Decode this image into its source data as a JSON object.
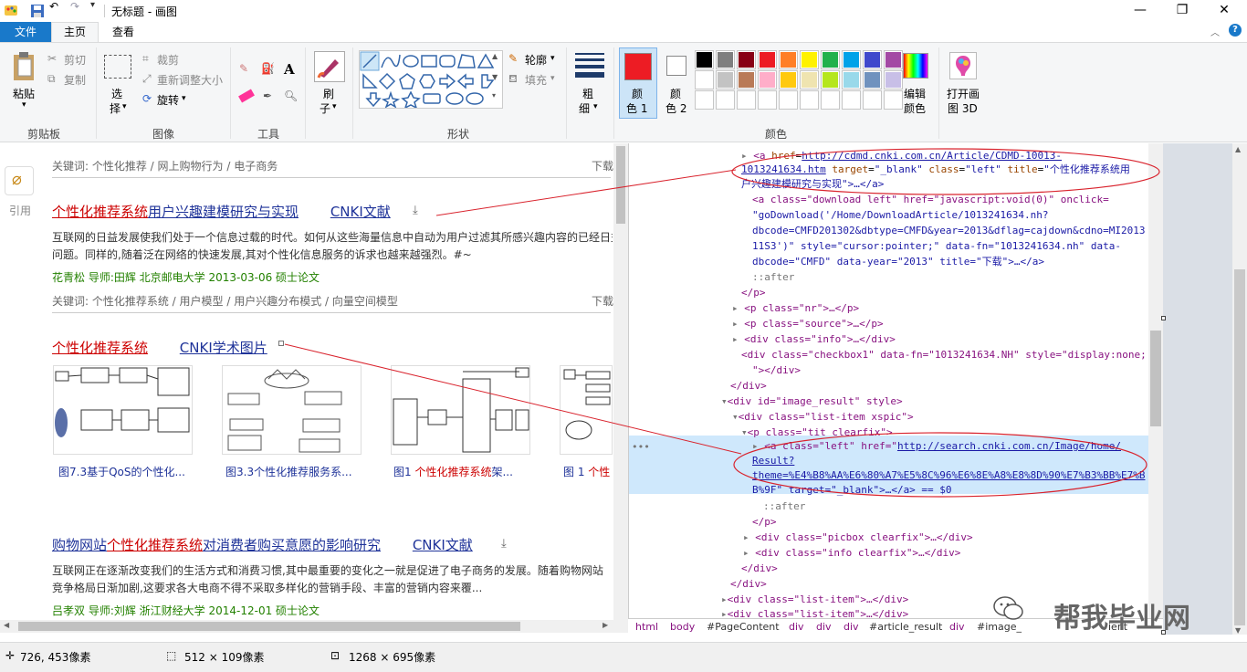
{
  "window": {
    "title": "无标题 - 画图"
  },
  "tabs": [
    "文件",
    "主页",
    "查看"
  ],
  "clipboard": {
    "paste": "粘贴",
    "cut": "剪切",
    "copy": "复制",
    "label": "剪贴板"
  },
  "image": {
    "select": "选",
    "select2": "择",
    "crop": "裁剪",
    "resize": "重新调整大小",
    "rotate": "旋转",
    "label": "图像"
  },
  "tools": {
    "label": "工具",
    "text_icon": "A"
  },
  "brush": {
    "l1": "刷",
    "l2": "子"
  },
  "shapes": {
    "outline": "轮廓",
    "fill": "填充",
    "label": "形状"
  },
  "size": {
    "l1": "粗",
    "l2": "细"
  },
  "colors": {
    "color1_l1": "颜",
    "color1_l2": "色 1",
    "color2_l1": "颜",
    "color2_l2": "色 2",
    "edit_l1": "编辑",
    "edit_l2": "颜色",
    "open3d_l1": "打开画",
    "open3d_l2": "图 3D",
    "label": "颜色",
    "color1": "#ed1c24",
    "color2": "#ffffff",
    "palette_row1": [
      "#000000",
      "#7f7f7f",
      "#880015",
      "#ed1c24",
      "#ff7f27",
      "#fff200",
      "#22b14c",
      "#00a2e8",
      "#3f48cc",
      "#a349a4"
    ],
    "palette_row2": [
      "#ffffff",
      "#c3c3c3",
      "#b97a57",
      "#ffaec9",
      "#ffc90e",
      "#efe4b0",
      "#b5e61d",
      "#99d9ea",
      "#7092be",
      "#c8bfe7"
    ]
  },
  "side": {
    "cite": "引用"
  },
  "results": {
    "kw1": "关键词:  个性化推荐 / 网上购物行为 / 电子商务",
    "dl": "下载",
    "r1_title_red": "个性化推荐系统",
    "r1_title_rest": "用户兴趣建模研究与实现",
    "r1_source": "CNKI文献",
    "r1_snip1": "互联网的日益发展使我们处于一个信息过载的时代。如何从这些海量信息中自动为用户过滤其所感兴趣内容的已经日益",
    "r1_snip2": "问题。同样的,随着泛在网络的快速发展,其对个性化信息服务的诉求也越来越强烈。#~",
    "r1_meta": "花青松  导师:田辉  北京邮电大学  2013-03-06  硕士论文",
    "kw2": "关键词:  个性化推荐系统 / 用户模型 / 用户兴趣分布模式 / 向量空间模型",
    "r2_title_red": "个性化推荐系统",
    "r2_source": "CNKI学术图片",
    "cap1": "图7.3基于QoS的个性化...",
    "cap2": "图3.3个性化推荐服务系...",
    "cap3_a": "图1  ",
    "cap3_red": "个性化推荐系统",
    "cap3_b": "架...",
    "cap4_a": "图 1  ",
    "cap4_red": "个性",
    "r3_title_a": "购物网站",
    "r3_title_red": "个性化推荐系统",
    "r3_title_b": "对消费者购买意愿的影响研究",
    "r3_source": "CNKI文献",
    "r3_snip1": "互联网正在逐渐改变我们的生活方式和消费习惯,其中最重要的变化之一就是促进了电子商务的发展。随着购物网站",
    "r3_snip2": "竞争格局日渐加剧,这要求各大电商不得不采取多样化的营销手段、丰富的营销内容来覆...",
    "r3_meta": "吕孝双  导师:刘辉  浙江财经大学  2014-12-01  硕士论文"
  },
  "devtools": {
    "l1_url": "http://cdmd.cnki.com.cn/Article/CDMD-10013-",
    "l2_url": "1013241634.htm",
    "l2_rest_target": "target",
    "l2_v_blank": "\"_blank\"",
    "l2_class": "class",
    "l2_v_left": "\"left\"",
    "l2_title": "title",
    "l2_v_title": "\"个性化推荐系统用",
    "l3": "户兴趣建模研究与实现\">…</a>",
    "l4": "<a class=\"download left\" href=\"javascript:void(0)\" onclick=",
    "l5": "\"goDownload('/Home/DownloadArticle/1013241634.nh?",
    "l6": "dbcode=CMFD201302&dbtype=CMFD&year=2013&dflag=cajdown&cdno=MI2013",
    "l7": "11S3')\" style=\"cursor:pointer;\" data-fn=\"1013241634.nh\" data-",
    "l8": "dbcode=\"CMFD\" data-year=\"2013\" title=\"下载\">…</a>",
    "l9": "::after",
    "l10": "</p>",
    "l11": "<p class=\"nr\">…</p>",
    "l12": "<p class=\"source\">…</p>",
    "l13": "<div class=\"info\">…</div>",
    "l14": "<div class=\"checkbox1\" data-fn=\"1013241634.NH\" style=\"display:none;",
    "l15": "\"></div>",
    "l16": "</div>",
    "l17": "<div id=\"image_result\" style>",
    "l18": "<div class=\"list-item xspic\">",
    "l19": "<p class=\"tit clearfix\">",
    "l20_pre": "<a class=\"left\" href=\"",
    "l20_url": "http://search.cnki.com.cn/Image/home/",
    "l21": "Result?",
    "l22": "theme=%E4%B8%AA%E6%80%A7%E5%8C%96%E6%8E%A8%E8%8D%90%E7%B3%BB%E7%B",
    "l23": "B%9F\" target=\"_blank\">…</a> == $0",
    "l24": "::after",
    "l25": "</p>",
    "l26": "<div class=\"picbox clearfix\">…</div>",
    "l27": "<div class=\"info clearfix\">…</div>",
    "l28": "</div>",
    "l29": "</div>",
    "l30": "<div class=\"list-item\">…</div>",
    "l31": "<div class=\"list-item\">…</div>",
    "dots": "•••",
    "crumbs": [
      "html",
      "body",
      "#PageContent",
      "div",
      "div",
      "div",
      "#article_result",
      "div",
      "#image_",
      "ient"
    ]
  },
  "watermark": {
    "text": "帮我毕业网"
  },
  "status": {
    "cursor": "726, 453像素",
    "selection": "512 × 109像素",
    "canvas": "1268 × 695像素"
  }
}
